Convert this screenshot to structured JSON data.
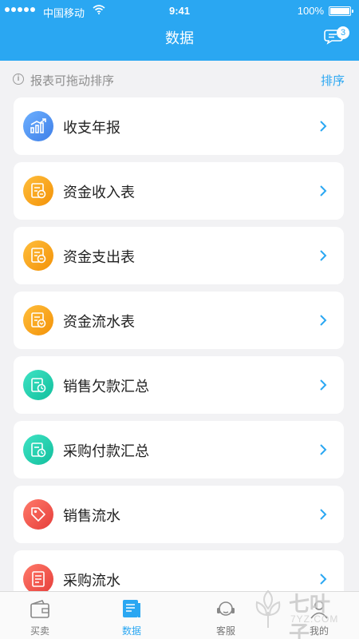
{
  "status_bar": {
    "carrier": "中国移动",
    "time": "9:41",
    "battery": "100%"
  },
  "header": {
    "title": "数据",
    "message_count": "3"
  },
  "hint": {
    "text": "报表可拖动排序",
    "sort_label": "排序"
  },
  "reports": [
    {
      "label": "收支年报",
      "icon": "chart-growth-icon",
      "color": "#4a8ef0"
    },
    {
      "label": "资金收入表",
      "icon": "income-ledger-icon",
      "color": "#f7a21b"
    },
    {
      "label": "资金支出表",
      "icon": "expense-ledger-icon",
      "color": "#f7a21b"
    },
    {
      "label": "资金流水表",
      "icon": "cashflow-ledger-icon",
      "color": "#f7a21b"
    },
    {
      "label": "销售欠款汇总",
      "icon": "sales-debt-icon",
      "color": "#1fcfb0"
    },
    {
      "label": "采购付款汇总",
      "icon": "purchase-payment-icon",
      "color": "#1fcfb0"
    },
    {
      "label": "销售流水",
      "icon": "sales-tag-icon",
      "color": "#f1514b"
    },
    {
      "label": "采购流水",
      "icon": "purchase-list-icon",
      "color": "#f1514b"
    }
  ],
  "tabs": [
    {
      "label": "买卖",
      "icon": "wallet-icon"
    },
    {
      "label": "数据",
      "icon": "data-icon",
      "active": true
    },
    {
      "label": "客服",
      "icon": "headset-icon"
    },
    {
      "label": "我的",
      "icon": "person-icon"
    }
  ],
  "watermark": {
    "text": "七叶子",
    "sub": "7YZ.COM"
  },
  "colors": {
    "primary": "#2aa7f2",
    "background": "#f2f2f4"
  }
}
